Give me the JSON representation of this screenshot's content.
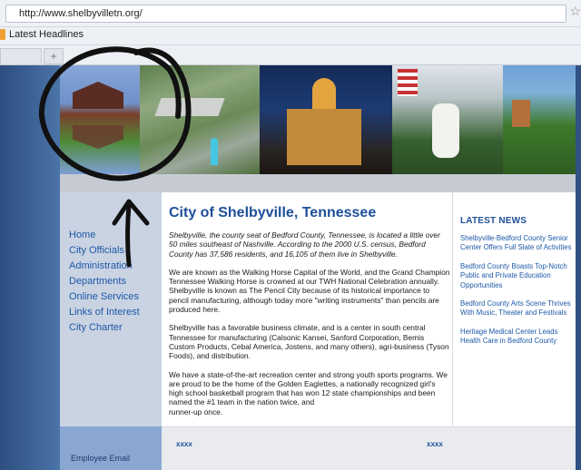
{
  "browser": {
    "url": "http://www.shelbyvilletn.org/",
    "bookmark_label": "Latest Headlines",
    "new_tab_glyph": "+",
    "star_icon": "star-icon"
  },
  "site": {
    "title": "City of Shelbyville, Tennessee",
    "paragraphs": [
      "Shelbyville, the county seat of Bedford County, Tennessee, is located a little over 50 miles southeast of  Nashville.  According to the 2000  U.S. census, Bedford County has 37,586 residents, and 16,105 of them live in Shelbyville.",
      "We are known as the Walking Horse Capital of the World, and the Grand Champion Tennessee Walking Horse is crowned at our TWH National  Celebration annually.  Shelbyville is known as The Pencil City because of its historical importance to pencil manufacturing, although today more  \"writing instruments\" than pencils are produced here.",
      "Shelbyville has a favorable business climate, and is a center in south central Tennessee for manufacturing (Calsonic Kansei, Sanford Corporation, Bemis Custom Products, Cebal America, Jostens, and many others), agri-business (Tyson Foods), and distribution.",
      "We have a state-of-the-art recreation center and strong youth sports programs.  We are proud to be the home of the Golden Eaglettes, a nationally recognized  girl's high school basketball program that has won 12 state championships and been named the #1 team in the nation twice, and\nrunner-up once."
    ],
    "nav": [
      "Home",
      "City Officials",
      "Administration",
      "Departments",
      "Online Services",
      "Links of Interest",
      "City Charter"
    ],
    "employee_email": "Employee Email",
    "news_heading": "LATEST NEWS",
    "news": [
      "Shelbyville-Bedford County Senior Center Offers Full Slate of Activities",
      "Bedford County Boasts Top-Notch Public and Private Education Opportunities",
      "Bedford County Arts Scene Thrives With Music, Theater and Festivals",
      "Heritage Medical Center Leads Health Care in Bedford County"
    ],
    "footer_links": [
      "xxxx",
      "xxxx"
    ]
  },
  "colors": {
    "accent_blue": "#1e4f99",
    "link_blue": "#1e58a8",
    "frame_blue": "#3a5f92",
    "annotation": "#111111"
  }
}
